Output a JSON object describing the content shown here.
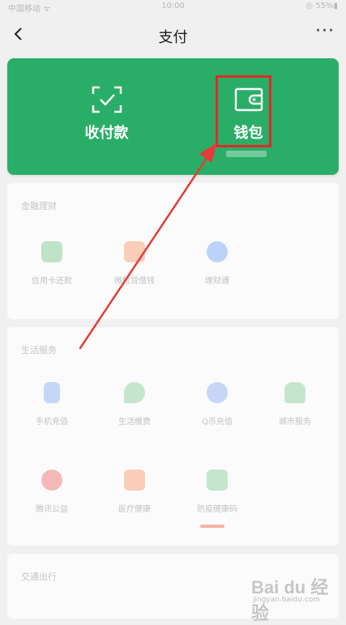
{
  "status_bar": {
    "carrier": "中国移动 ᯤ",
    "time": "10:00",
    "battery": "◎ 55%▮"
  },
  "nav": {
    "title": "支付",
    "more": "···"
  },
  "wallet_card": {
    "pay_label": "收付款",
    "wallet_label": "钱包",
    "background": "#2aae67",
    "highlight_color": "#e02a2a"
  },
  "sections": [
    {
      "title": "金融理财",
      "items": [
        {
          "label": "信用卡还款",
          "icon": "credit-card-icon",
          "color": "#bfe3c8"
        },
        {
          "label": "微粒贷借钱",
          "icon": "loan-icon",
          "color": "#f9cdb8"
        },
        {
          "label": "理财通",
          "icon": "wealth-icon",
          "color": "#bcd3f7"
        }
      ]
    },
    {
      "title": "生活服务",
      "items": [
        {
          "label": "手机充值",
          "icon": "phone-icon",
          "color": "#c6d6f7"
        },
        {
          "label": "生活缴费",
          "icon": "utility-icon",
          "color": "#c5e6cd"
        },
        {
          "label": "Q币充值",
          "icon": "qcoin-icon",
          "color": "#c6d6f7"
        },
        {
          "label": "城市服务",
          "icon": "city-icon",
          "color": "#c5e6cd"
        },
        {
          "label": "腾讯公益",
          "icon": "charity-icon",
          "color": "#f5b8b8"
        },
        {
          "label": "医疗健康",
          "icon": "medical-icon",
          "color": "#f9cdb8"
        },
        {
          "label": "防疫健康码",
          "icon": "health-code-icon",
          "color": "#c5e6cd"
        }
      ]
    },
    {
      "title": "交通出行",
      "items": []
    }
  ],
  "watermark": {
    "main": "Bai du 经验",
    "sub": "jingyan.baidu.com"
  }
}
